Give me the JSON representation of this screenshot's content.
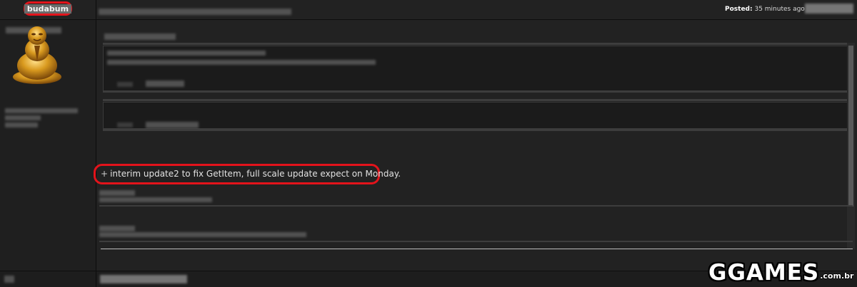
{
  "post": {
    "author": "budabum",
    "posted_label": "Posted:",
    "posted_time": "35 minutes ago",
    "message_prefix": "+",
    "message": "interim update2 to fix GetItem, full scale update expect on Monday."
  },
  "watermark": {
    "logo_main": "GGAMES",
    "logo_sub": ".com.br"
  },
  "colors": {
    "highlight": "#e3131b",
    "background": "#1a1a1a",
    "panel": "#222222"
  }
}
